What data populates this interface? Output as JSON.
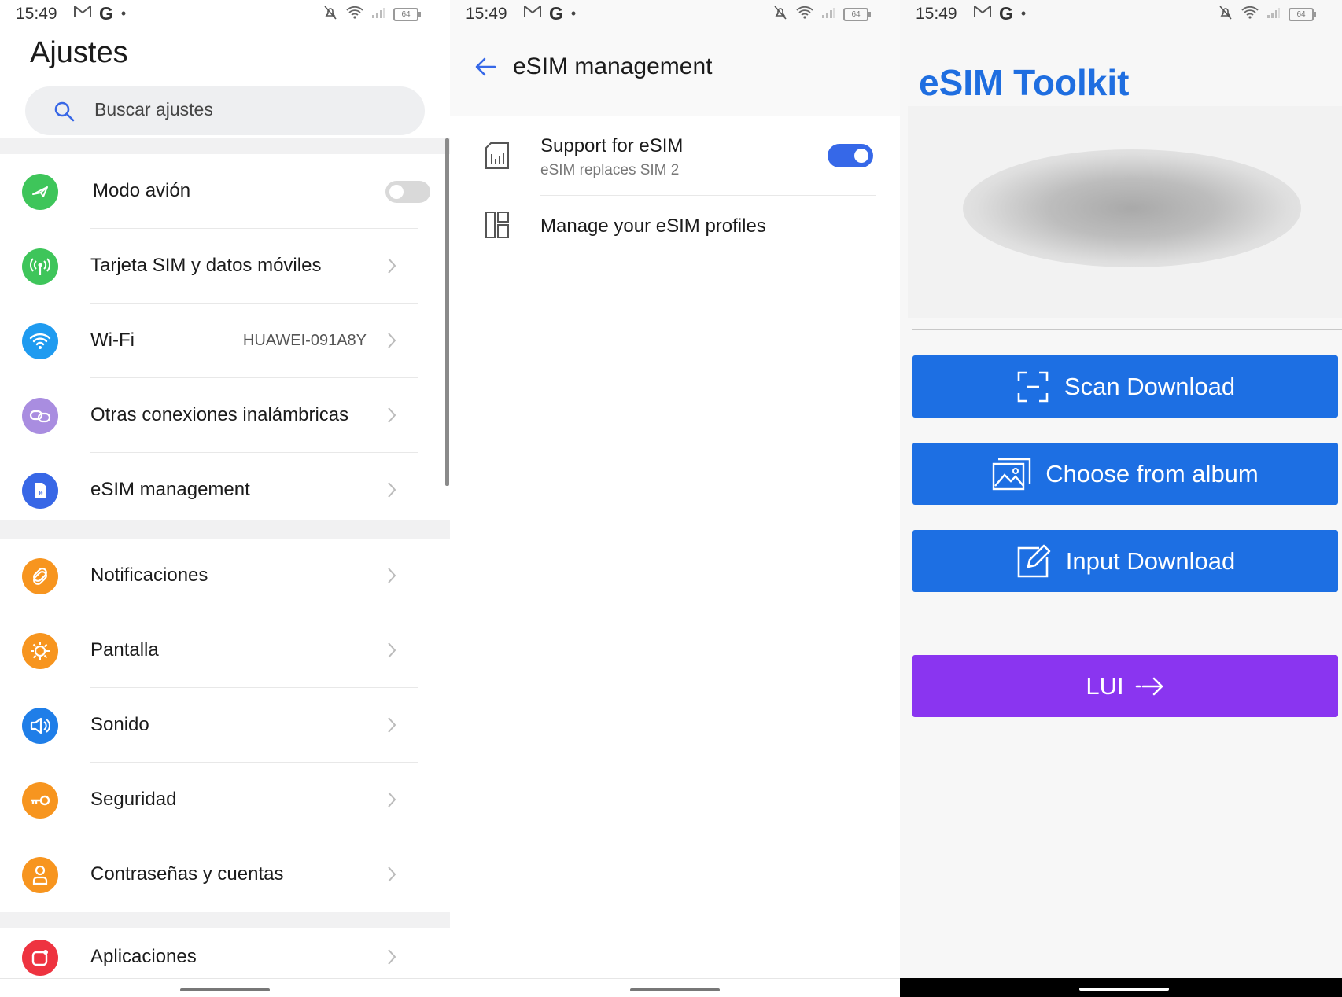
{
  "status_bar": {
    "time": "15:49",
    "gmail_icon": "gmail-icon",
    "google_icon_text": "G",
    "dot": "•",
    "battery": "64"
  },
  "settings": {
    "title": "Ajustes",
    "search_placeholder": "Buscar ajustes",
    "items": [
      {
        "label": "Modo avión",
        "icon": "airplane-icon",
        "color": "#3ec55a",
        "control": "toggle-off"
      },
      {
        "label": "Tarjeta SIM y datos móviles",
        "icon": "antenna-icon",
        "color": "#3ec55a"
      },
      {
        "label": "Wi-Fi",
        "value": "HUAWEI-091A8Y",
        "icon": "wifi-icon",
        "color": "#1f9bf0"
      },
      {
        "label": "Otras conexiones inalámbricas",
        "icon": "link-icon",
        "color": "#a98de0"
      },
      {
        "label": "eSIM management",
        "icon": "esim-icon",
        "color": "#3867e6"
      },
      {
        "label": "Notificaciones",
        "icon": "bell-icon",
        "color": "#f7951f"
      },
      {
        "label": "Pantalla",
        "icon": "brightness-icon",
        "color": "#f7951f"
      },
      {
        "label": "Sonido",
        "icon": "speaker-icon",
        "color": "#1f7ee8"
      },
      {
        "label": "Seguridad",
        "icon": "key-icon",
        "color": "#f7951f"
      },
      {
        "label": "Contraseñas y cuentas",
        "icon": "account-icon",
        "color": "#f7951f"
      },
      {
        "label": "Aplicaciones",
        "icon": "apps-icon",
        "color": "#ee3340"
      }
    ]
  },
  "esim_management": {
    "title": "eSIM management",
    "support_title": "Support for eSIM",
    "support_subtitle": "eSIM replaces SIM 2",
    "support_enabled": true,
    "manage_profiles": "Manage your eSIM profiles"
  },
  "toolkit": {
    "title": "eSIM Toolkit",
    "buttons": {
      "scan": "Scan Download",
      "album": "Choose from album",
      "input": "Input Download",
      "lui": "LUI"
    },
    "colors": {
      "primary": "#1d6fe3",
      "lui": "#8a35f0",
      "title": "#1f6ee0"
    }
  }
}
